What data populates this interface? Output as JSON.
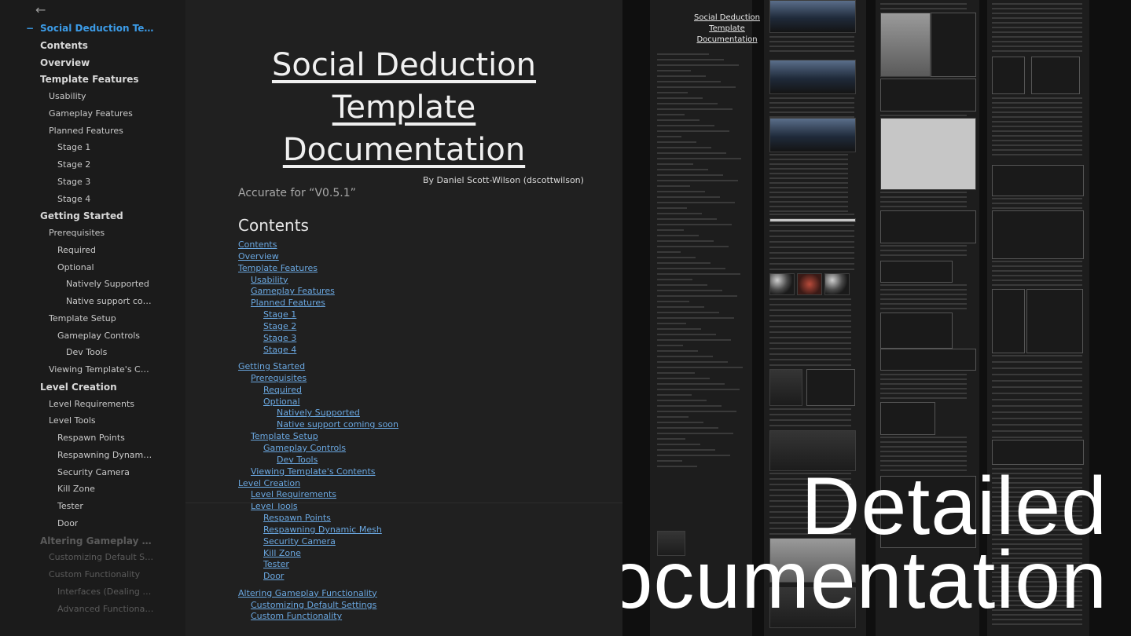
{
  "sidebar": {
    "back_icon": "arrow-left-icon",
    "items": [
      {
        "label": "Social Deduction Template ...",
        "level": 0,
        "active": true
      },
      {
        "label": "Contents",
        "level": 0
      },
      {
        "label": "Overview",
        "level": 0
      },
      {
        "label": "Template Features",
        "level": 0
      },
      {
        "label": "Usability",
        "level": 1
      },
      {
        "label": "Gameplay Features",
        "level": 1
      },
      {
        "label": "Planned Features",
        "level": 1
      },
      {
        "label": "Stage 1",
        "level": 2
      },
      {
        "label": "Stage 2",
        "level": 2
      },
      {
        "label": "Stage 3",
        "level": 2
      },
      {
        "label": "Stage 4",
        "level": 2
      },
      {
        "label": "Getting Started",
        "level": 0
      },
      {
        "label": "Prerequisites",
        "level": 1
      },
      {
        "label": "Required",
        "level": 2
      },
      {
        "label": "Optional",
        "level": 2
      },
      {
        "label": "Natively Supported",
        "level": 3
      },
      {
        "label": "Native support coming ...",
        "level": 3
      },
      {
        "label": "Template Setup",
        "level": 1
      },
      {
        "label": "Gameplay Controls",
        "level": 2
      },
      {
        "label": "Dev Tools",
        "level": 3
      },
      {
        "label": "Viewing Template's Contents",
        "level": 1
      },
      {
        "label": "Level Creation",
        "level": 0
      },
      {
        "label": "Level Requirements",
        "level": 1
      },
      {
        "label": "Level Tools",
        "level": 1
      },
      {
        "label": "Respawn Points",
        "level": 2
      },
      {
        "label": "Respawning Dynamic Mesh",
        "level": 2
      },
      {
        "label": "Security Camera",
        "level": 2
      },
      {
        "label": "Kill Zone",
        "level": 2
      },
      {
        "label": "Tester",
        "level": 2
      },
      {
        "label": "Door",
        "level": 2
      },
      {
        "label": "Altering Gameplay Functio...",
        "level": 0,
        "faded": true
      },
      {
        "label": "Customizing Default Settings",
        "level": 1,
        "faded": true
      },
      {
        "label": "Custom Functionality",
        "level": 1,
        "faded": true
      },
      {
        "label": "Interfaces (Dealing damag...",
        "level": 2,
        "faded": true
      },
      {
        "label": "Advanced Functionality",
        "level": 2,
        "faded": true
      }
    ]
  },
  "doc": {
    "title_lines": [
      "Social Deduction",
      "Template",
      "Documentation"
    ],
    "byline": "By Daniel Scott-Wilson (dscottwilson)",
    "accurate": "Accurate for “V0.5.1”",
    "contents_heading": "Contents",
    "toc": [
      {
        "label": "Contents",
        "level": 0
      },
      {
        "label": "Overview",
        "level": 0
      },
      {
        "label": "Template Features",
        "level": 0
      },
      {
        "label": "Usability",
        "level": 1
      },
      {
        "label": "Gameplay Features",
        "level": 1
      },
      {
        "label": "Planned Features",
        "level": 1
      },
      {
        "label": "Stage 1",
        "level": 2
      },
      {
        "label": "Stage 2",
        "level": 2
      },
      {
        "label": "Stage 3",
        "level": 2
      },
      {
        "label": "Stage 4",
        "level": 2
      },
      {
        "label": "Getting Started",
        "level": 0
      },
      {
        "label": "Prerequisites",
        "level": 1
      },
      {
        "label": "Required",
        "level": 2
      },
      {
        "label": "Optional",
        "level": 2
      },
      {
        "label": "Natively Supported",
        "level": 3
      },
      {
        "label": "Native support coming soon",
        "level": 3
      },
      {
        "label": "Template Setup",
        "level": 1
      },
      {
        "label": "Gameplay Controls",
        "level": 2
      },
      {
        "label": "Dev Tools",
        "level": 3
      },
      {
        "label": "Viewing Template's Contents",
        "level": 1
      },
      {
        "label": "Level Creation",
        "level": 0
      },
      {
        "label": "Level Requirements",
        "level": 1
      },
      {
        "label": "Level Tools",
        "level": 1
      },
      {
        "label": "Respawn Points",
        "level": 2
      },
      {
        "label": "Respawning Dynamic Mesh",
        "level": 2
      },
      {
        "label": "Security Camera",
        "level": 2
      },
      {
        "label": "Kill Zone",
        "level": 2
      },
      {
        "label": "Tester",
        "level": 2
      },
      {
        "label": "Door",
        "level": 2
      },
      {
        "label": "Altering Gameplay Functionality",
        "level": 0
      },
      {
        "label": "Customizing Default Settings",
        "level": 1
      },
      {
        "label": "Custom Functionality",
        "level": 1
      }
    ]
  },
  "preview": {
    "title": "Social Deduction Template Documentation"
  },
  "overlay": {
    "line1": "Detailed",
    "line2": "Documentation"
  },
  "colors": {
    "accent": "#3c9ce8",
    "link": "#6aa7e0",
    "background": "#141414"
  }
}
